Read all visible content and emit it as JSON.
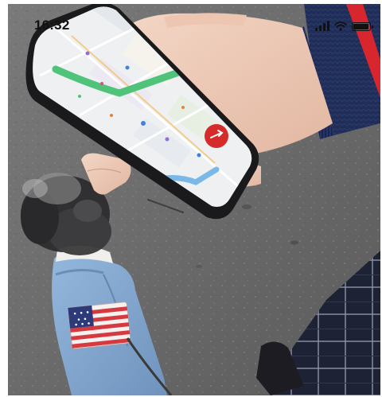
{
  "status_bar": {
    "time": "16:32",
    "battery_level": 0.95,
    "signal_bars": 4
  },
  "photo": {
    "map_destination_badge": "→"
  },
  "colors": {
    "pavement": "#6f6f6f",
    "sleeve_navy": "#1f2d57",
    "sleeve_red": "#d8262e",
    "dog_coat_blue": "#7fa6cf",
    "map_route_green": "#4fc37a",
    "map_water_blue": "#7ab8e8",
    "destination_red": "#d52b2b"
  }
}
